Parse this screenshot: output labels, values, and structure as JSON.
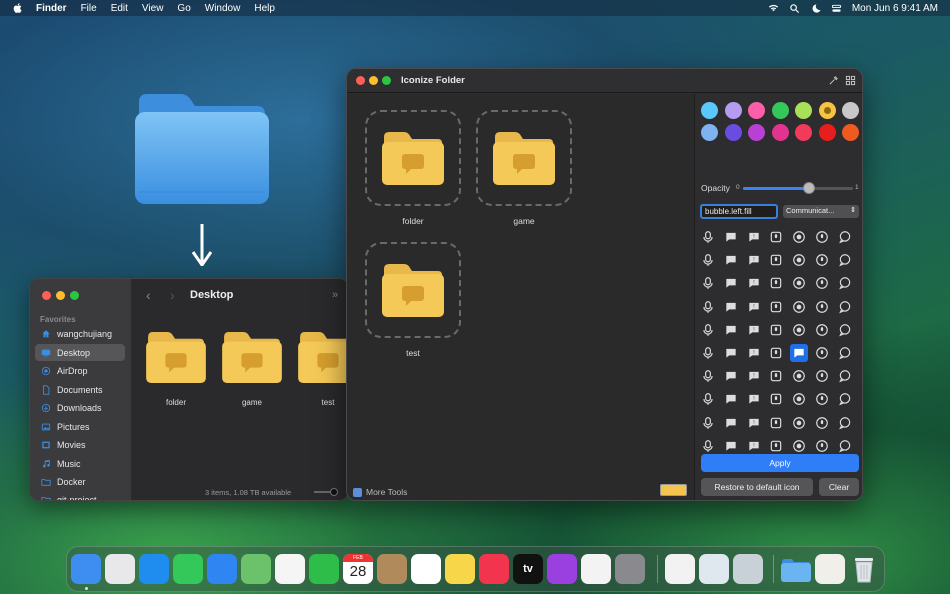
{
  "menubar": {
    "app": "Finder",
    "items": [
      "File",
      "Edit",
      "View",
      "Go",
      "Window",
      "Help"
    ],
    "clock": "Mon Jun 6  9:41 AM"
  },
  "finder": {
    "sidebar_section": "Favorites",
    "sidebar_items": [
      {
        "label": "wangchujiang",
        "icon": "home-icon"
      },
      {
        "label": "Desktop",
        "icon": "desktop-icon"
      },
      {
        "label": "AirDrop",
        "icon": "airdrop-icon"
      },
      {
        "label": "Documents",
        "icon": "document-icon"
      },
      {
        "label": "Downloads",
        "icon": "download-icon"
      },
      {
        "label": "Pictures",
        "icon": "picture-icon"
      },
      {
        "label": "Movies",
        "icon": "movie-icon"
      },
      {
        "label": "Music",
        "icon": "music-icon"
      },
      {
        "label": "Docker",
        "icon": "folder-icon"
      },
      {
        "label": "git-project",
        "icon": "folder-icon"
      }
    ],
    "title": "Desktop",
    "files": [
      "folder",
      "game",
      "test"
    ],
    "status": "3 items, 1.08 TB available"
  },
  "iconize": {
    "title": "Iconize Folder",
    "folders": [
      "folder",
      "game",
      "test"
    ],
    "more_tools": "More Tools",
    "swatch_color": "#f4c44f",
    "colors_row1": [
      "#5ac8fa",
      "#b69cf0",
      "#ff5fa8",
      "#34c759",
      "#a8e05a",
      "#f6c342",
      "#c8c8cc"
    ],
    "colors_row2": [
      "#7fb2f0",
      "#6a4de0",
      "#b93fd6",
      "#e2348f",
      "#f23b5a",
      "#e81e1e",
      "#f05a1e"
    ],
    "selected_color_index": 5,
    "opacity_label": "Opacity",
    "opacity_min": "0",
    "opacity_max": "1",
    "opacity_value": 0.6,
    "symbol_name": "bubble.left.fill",
    "category": "Communicat...",
    "apply_label": "Apply",
    "restore_label": "Restore to default icon",
    "clear_label": "Clear"
  },
  "dock": {
    "apps": [
      {
        "name": "finder-icon",
        "color": "#3d8ef0"
      },
      {
        "name": "launchpad-icon",
        "color": "#e8e8ea"
      },
      {
        "name": "safari-icon",
        "color": "#1f8cf0"
      },
      {
        "name": "messages-icon",
        "color": "#34c759"
      },
      {
        "name": "mail-icon",
        "color": "#2f86f2"
      },
      {
        "name": "maps-icon",
        "color": "#6bc26b"
      },
      {
        "name": "photos-icon",
        "color": "#f5f5f5"
      },
      {
        "name": "facetime-icon",
        "color": "#2fbd4a"
      },
      {
        "name": "calendar-icon",
        "color": "#ffffff"
      },
      {
        "name": "contacts-icon",
        "color": "#b08a5a"
      },
      {
        "name": "reminders-icon",
        "color": "#ffffff"
      },
      {
        "name": "notes-icon",
        "color": "#f7d64a"
      },
      {
        "name": "music-icon",
        "color": "#f3344e"
      },
      {
        "name": "tv-icon",
        "color": "#111111"
      },
      {
        "name": "podcasts-icon",
        "color": "#9a3fe0"
      },
      {
        "name": "news-icon",
        "color": "#f3f3f3"
      },
      {
        "name": "settings-icon",
        "color": "#8a8a8e"
      },
      {
        "name": "textedit-icon",
        "color": "#f2f2f2"
      },
      {
        "name": "preview-icon",
        "color": "#dfe7ef"
      },
      {
        "name": "iconize-icon",
        "color": "#c8d0d8"
      },
      {
        "name": "downloads-folder-icon",
        "color": "#5fb0f0"
      },
      {
        "name": "document-stack-icon",
        "color": "#f0efe9"
      },
      {
        "name": "trash-icon",
        "color": "#d8dde2"
      }
    ],
    "calendar_month": "FEB",
    "calendar_day": "28",
    "tv_label": "tv"
  }
}
